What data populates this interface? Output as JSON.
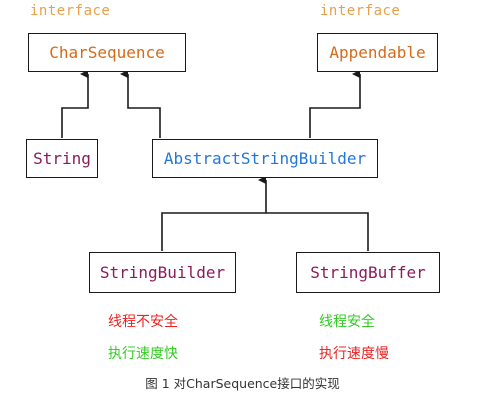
{
  "stereotypes": {
    "left": "interface",
    "right": "interface"
  },
  "nodes": {
    "char_sequence": "CharSequence",
    "appendable": "Appendable",
    "string": "String",
    "abstract_builder": "AbstractStringBuilder",
    "string_builder": "StringBuilder",
    "string_buffer": "StringBuffer"
  },
  "notes": {
    "builder_thread": "线程不安全",
    "builder_speed": "执行速度快",
    "buffer_thread": "线程安全",
    "buffer_speed": "执行速度慢"
  },
  "colors": {
    "interface": "#d46a1a",
    "class": "#8b1a5c",
    "abstract": "#2277dd",
    "stereotype": "#e8a04a",
    "unsafe": "#ee2222",
    "safe": "#33cc22"
  },
  "caption": "图 1  对CharSequence接口的实现"
}
